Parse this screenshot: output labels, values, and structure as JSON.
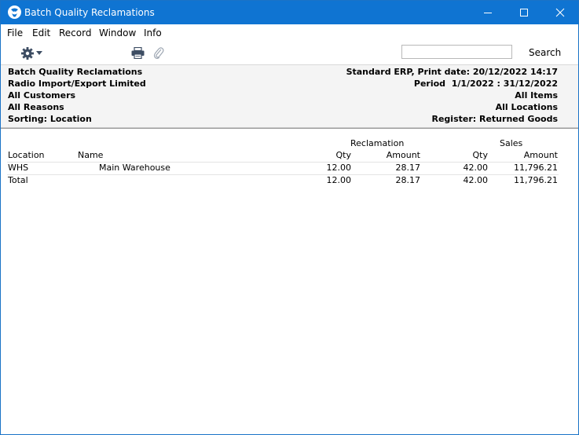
{
  "window": {
    "title": "Batch Quality Reclamations",
    "controls": [
      "minimize",
      "maximize",
      "close"
    ]
  },
  "menu": [
    "File",
    "Edit",
    "Record",
    "Window",
    "Info"
  ],
  "toolbar": {
    "icons": [
      "gear-icon",
      "printer-icon",
      "paperclip-icon"
    ],
    "search_value": "",
    "search_label": "Search"
  },
  "header": {
    "left": [
      "Batch Quality Reclamations",
      "Radio Import/Export Limited",
      "All Customers",
      "All Reasons",
      "Sorting: Location"
    ],
    "right": [
      "Standard ERP, Print date: 20/12/2022 14:17",
      "Period  1/1/2022 : 31/12/2022",
      "All Items",
      "All Locations",
      "Register: Returned Goods"
    ]
  },
  "report": {
    "group_headers": {
      "reclamation": "Reclamation",
      "sales": "Sales"
    },
    "columns": {
      "location": "Location",
      "name": "Name",
      "recl_qty": "Qty",
      "recl_amount": "Amount",
      "sales_qty": "Qty",
      "sales_amount": "Amount"
    },
    "rows": [
      {
        "location": "WHS",
        "name": "Main Warehouse",
        "recl_qty": "12.00",
        "recl_amount": "28.17",
        "sales_qty": "42.00",
        "sales_amount": "11,796.21"
      }
    ],
    "total": {
      "label": "Total",
      "recl_qty": "12.00",
      "recl_amount": "28.17",
      "sales_qty": "42.00",
      "sales_amount": "11,796.21"
    }
  }
}
